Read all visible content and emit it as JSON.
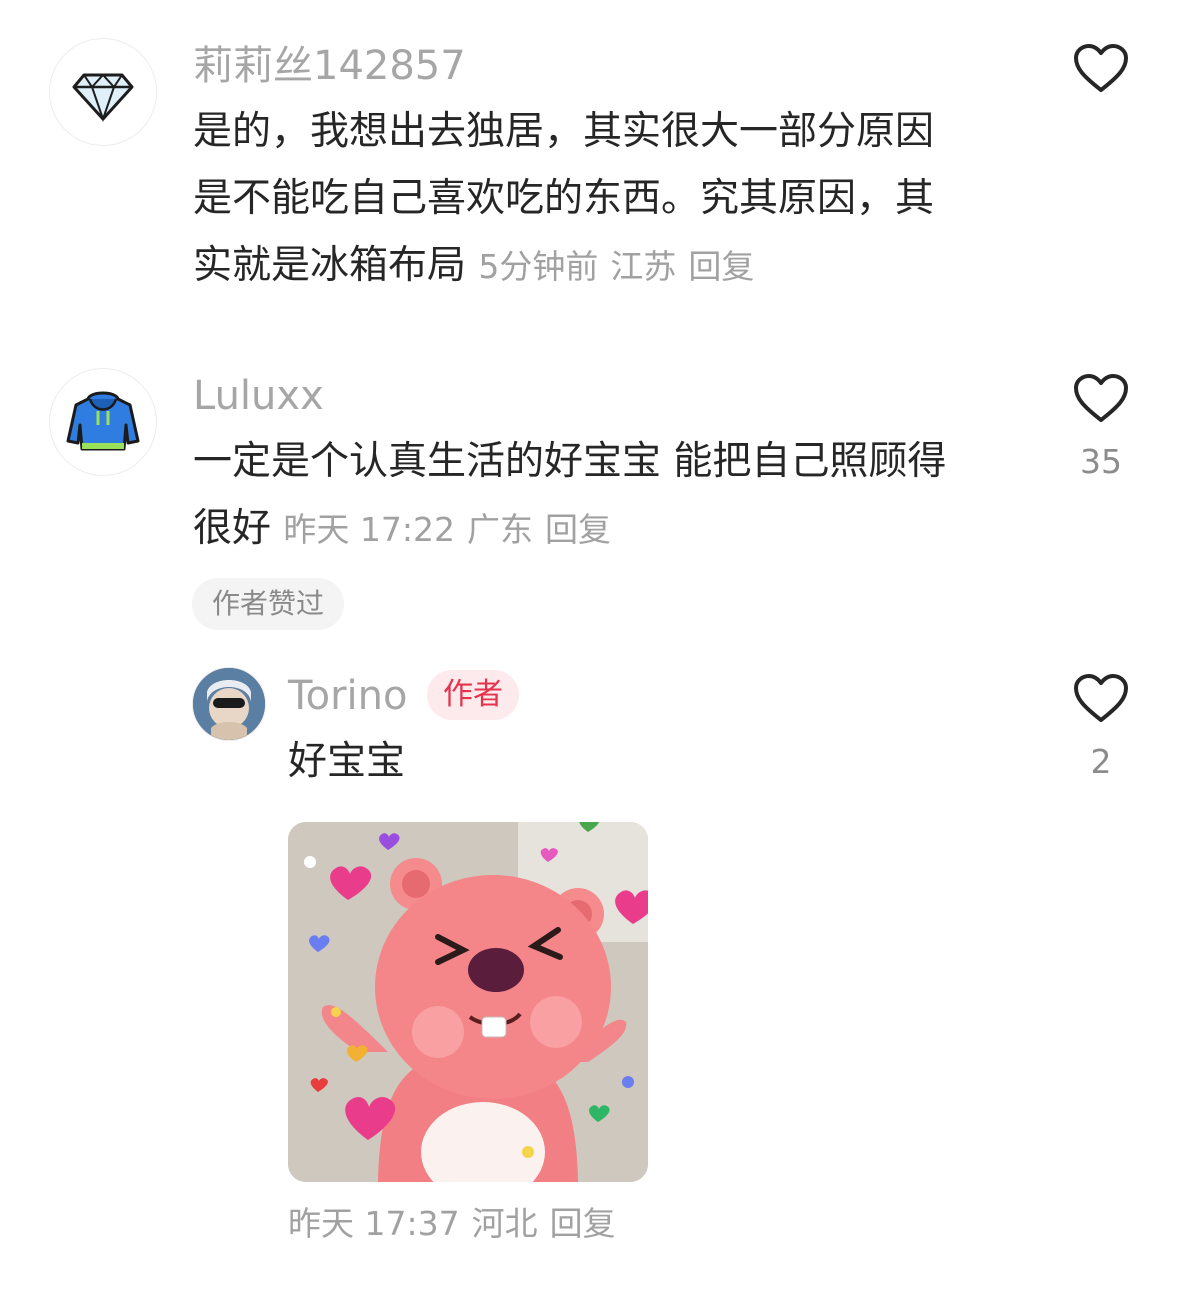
{
  "comments": [
    {
      "username": "莉莉丝142857",
      "avatar_icon": "diamond-icon",
      "text": "是的，我想出去独居，其实很大一部分原因是不能吃自己喜欢吃的东西。究其原因，其实就是冰箱布局",
      "line1": "是的，我想出去独居，其实很大一部分原因",
      "line2": "是不能吃自己喜欢吃的东西。究其原因，其",
      "line3": "实就是冰箱布局",
      "time": "5分钟前",
      "location": "江苏",
      "reply_label": "回复",
      "like_count": ""
    },
    {
      "username": "Luluxx",
      "avatar_icon": "hoodie-icon",
      "line1": "一定是个认真生活的好宝宝 能把自己照顾得",
      "line2": "很好",
      "time": "昨天 17:22",
      "location": "广东",
      "reply_label": "回复",
      "like_count": "35",
      "author_liked_label": "作者赞过"
    }
  ],
  "reply": {
    "username": "Torino",
    "author_badge": "作者",
    "text": "好宝宝",
    "time": "昨天 17:37",
    "location": "河北",
    "reply_label": "回复",
    "like_count": "2",
    "sticker": "pink-beaver-sticker"
  },
  "colors": {
    "text": "#262626",
    "meta": "#a1a1a1",
    "badge_bg": "#fdeaec",
    "badge_text": "#e5334c"
  }
}
